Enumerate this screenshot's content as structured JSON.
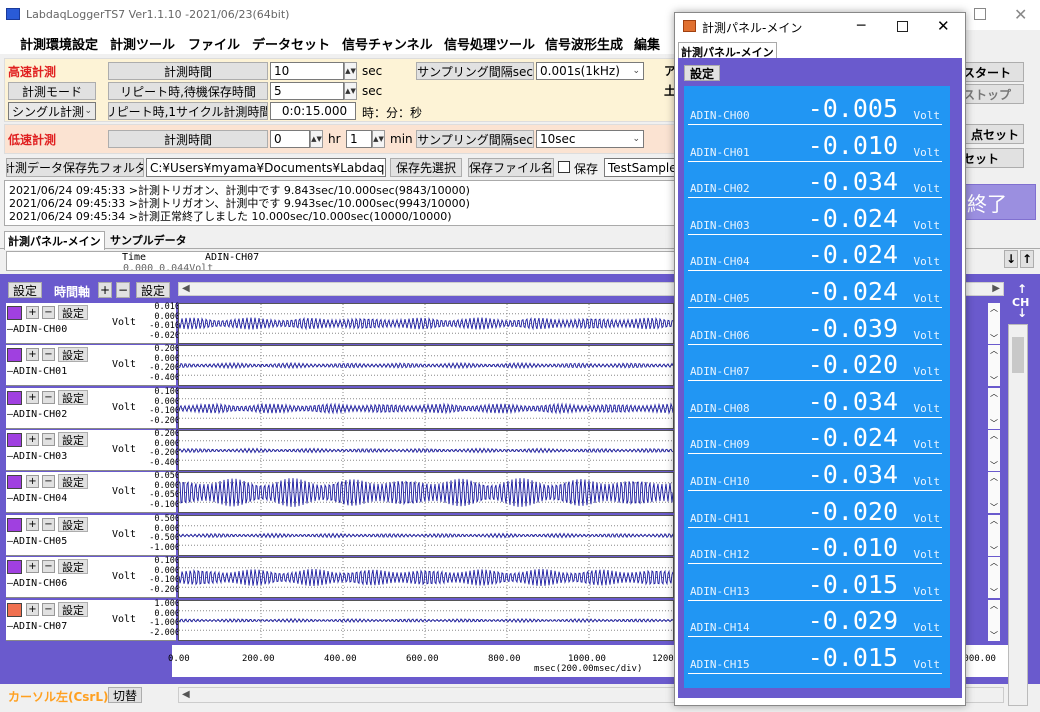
{
  "main_window": {
    "title": "LabdaqLoggerTS7 Ver1.1.10 -2021/06/23(64bit)",
    "menu": [
      "計測環境設定",
      "計測ツール",
      "ファイル",
      "データセット",
      "信号チャンネル",
      "信号処理ツール",
      "信号波形生成",
      "編集"
    ]
  },
  "high_speed": {
    "section_label": "高速計測",
    "measure_time_btn": "計測時間",
    "measure_time_value": "10",
    "unit_sec": "sec",
    "mode_btn": "計測モード",
    "repeat_wait_btn": "リピート時,待機保存時間",
    "repeat_wait_value": "5",
    "single_combo": "シングル計測",
    "repeat_cycle_btn": "リピート時,1サイクル計測時間",
    "repeat_cycle_value": "0:0:15.000",
    "hms_label": "時：分：秒",
    "sampling_btn": "サンプリング間隔sec",
    "sampling_value": "0.001s(1kHz)"
  },
  "low_speed": {
    "section_label": "低速計測",
    "measure_time_btn": "計測時間",
    "hr_value": "0",
    "hr_label": "hr",
    "min_value": "1",
    "min_label": "min",
    "sampling_btn": "サンプリング間隔sec",
    "sampling_value": "10sec"
  },
  "save_row": {
    "folder_btn": "計測データ保存先フォルダ",
    "folder_path": "C:¥Users¥myama¥Documents¥LabdaqLo",
    "select_btn": "保存先選択",
    "filename_btn": "保存ファイル名",
    "save_check_label": "保存",
    "filename_value": "TestSample"
  },
  "right_buttons": {
    "start": "スタート",
    "stop": "ストップ",
    "zero": "点セット",
    "reset": "リセット",
    "end": "終了",
    "partial_a": "ア",
    "partial_b": "土"
  },
  "log": [
    "2021/06/24 09:45:33 >計測トリガオン、計測中です 9.843sec/10.000sec(9843/10000)",
    "2021/06/24 09:45:33 >計測トリガオン、計測中です 9.943sec/10.000sec(9943/10000)",
    "2021/06/24 09:45:34 >計測正常終了しました 10.000sec/10.000sec(10000/10000)"
  ],
  "tabs": [
    "計測パネル-メイン",
    "サンプルデータ"
  ],
  "data_header": {
    "col1": "Time",
    "col2": "ADIN-CH07",
    "row_partial": "0.000      0.044Volt"
  },
  "toolbar": {
    "settings": "設定",
    "time_axis": "時間軸",
    "plus": "+",
    "minus": "−",
    "settings2": "設定"
  },
  "channels": [
    {
      "name": "ADIN-CH00",
      "unit": "Volt",
      "scale": [
        "0.010",
        "0.000",
        "-0.010",
        "-0.020"
      ],
      "color": "#a040e0"
    },
    {
      "name": "ADIN-CH01",
      "unit": "Volt",
      "scale": [
        "0.200",
        "0.000",
        "-0.200",
        "-0.400"
      ],
      "color": "#a040e0"
    },
    {
      "name": "ADIN-CH02",
      "unit": "Volt",
      "scale": [
        "0.100",
        "0.000",
        "-0.100",
        "-0.200"
      ],
      "color": "#a040e0"
    },
    {
      "name": "ADIN-CH03",
      "unit": "Volt",
      "scale": [
        "0.200",
        "0.000",
        "-0.200",
        "-0.400"
      ],
      "color": "#a040e0"
    },
    {
      "name": "ADIN-CH04",
      "unit": "Volt",
      "scale": [
        "0.050",
        "0.000",
        "-0.050",
        "-0.100"
      ],
      "color": "#a040e0"
    },
    {
      "name": "ADIN-CH05",
      "unit": "Volt",
      "scale": [
        "0.500",
        "0.000",
        "-0.500",
        "-1.000"
      ],
      "color": "#a040e0"
    },
    {
      "name": "ADIN-CH06",
      "unit": "Volt",
      "scale": [
        "0.100",
        "0.000",
        "-0.100",
        "-0.200"
      ],
      "color": "#a040e0"
    },
    {
      "name": "ADIN-CH07",
      "unit": "Volt",
      "scale": [
        "1.000",
        "0.000",
        "-1.000",
        "-2.000"
      ],
      "color": "#f07050"
    }
  ],
  "x_axis": {
    "ticks": [
      "0.00",
      "200.00",
      "400.00",
      "600.00",
      "800.00",
      "1000.00",
      "1200"
    ],
    "right_tick": "2000.00",
    "label": "msec(200.00msec/div)"
  },
  "bottom": {
    "cursor_label": "カーソル左(CsrL)",
    "switch_btn": "切替"
  },
  "side": {
    "ch_label": "CH"
  },
  "panel_window": {
    "title": "計測パネル-メイン",
    "tab": "計測パネル-メイン",
    "settings_btn": "設定",
    "rows": [
      {
        "name": "ADIN-CH00",
        "value": "-0.005",
        "unit": "Volt"
      },
      {
        "name": "ADIN-CH01",
        "value": "-0.010",
        "unit": "Volt"
      },
      {
        "name": "ADIN-CH02",
        "value": "-0.034",
        "unit": "Volt"
      },
      {
        "name": "ADIN-CH03",
        "value": "-0.024",
        "unit": "Volt"
      },
      {
        "name": "ADIN-CH04",
        "value": "-0.024",
        "unit": "Volt"
      },
      {
        "name": "ADIN-CH05",
        "value": "-0.024",
        "unit": "Volt"
      },
      {
        "name": "ADIN-CH06",
        "value": "-0.039",
        "unit": "Volt"
      },
      {
        "name": "ADIN-CH07",
        "value": "-0.020",
        "unit": "Volt"
      },
      {
        "name": "ADIN-CH08",
        "value": "-0.034",
        "unit": "Volt"
      },
      {
        "name": "ADIN-CH09",
        "value": "-0.024",
        "unit": "Volt"
      },
      {
        "name": "ADIN-CH10",
        "value": "-0.034",
        "unit": "Volt"
      },
      {
        "name": "ADIN-CH11",
        "value": "-0.020",
        "unit": "Volt"
      },
      {
        "name": "ADIN-CH12",
        "value": "-0.010",
        "unit": "Volt"
      },
      {
        "name": "ADIN-CH13",
        "value": "-0.015",
        "unit": "Volt"
      },
      {
        "name": "ADIN-CH14",
        "value": "-0.029",
        "unit": "Volt"
      },
      {
        "name": "ADIN-CH15",
        "value": "-0.015",
        "unit": "Volt"
      }
    ]
  },
  "colors": {
    "panel_bg": "#6a5acd",
    "readout_bg": "#2196f3",
    "section_red": "#e02020",
    "wave": "#1a1aa0",
    "end_btn": "#9b8fe0"
  }
}
